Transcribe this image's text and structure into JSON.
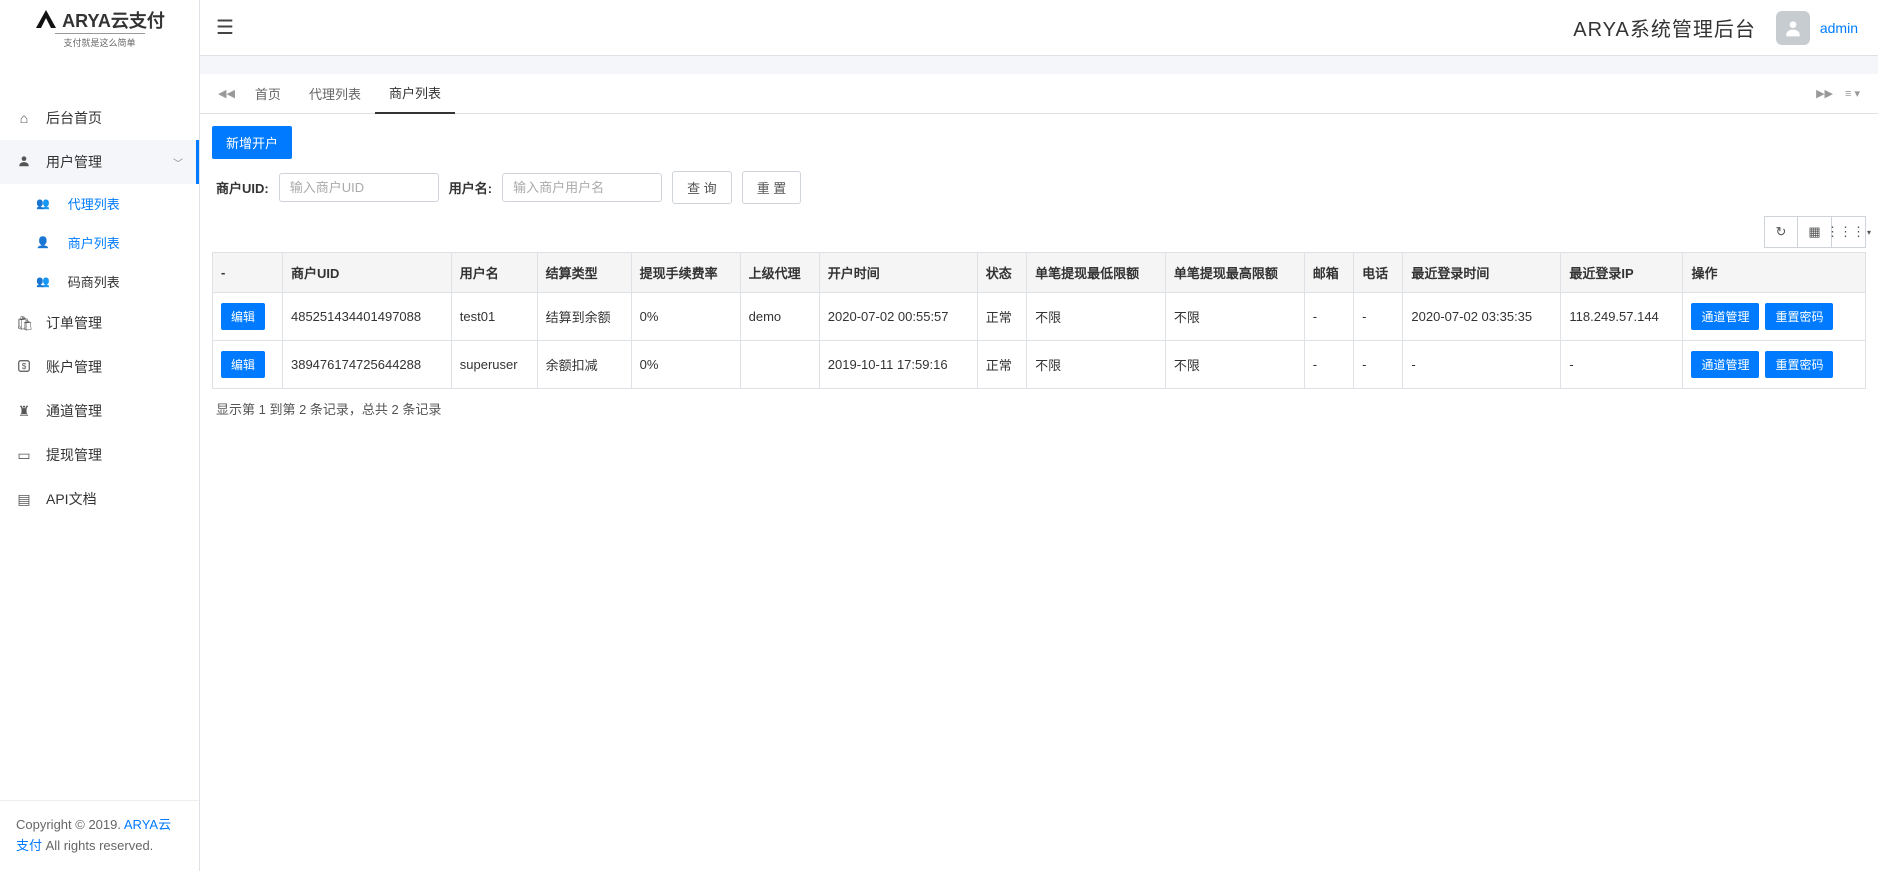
{
  "logo": {
    "brand": "ARYA云支付",
    "slogan": "支付就是这么简单"
  },
  "topbar": {
    "system_title": "ARYA系统管理后台",
    "username": "admin"
  },
  "sidebar": {
    "items": [
      {
        "label": "后台首页"
      },
      {
        "label": "用户管理",
        "expanded": true
      },
      {
        "label": "订单管理"
      },
      {
        "label": "账户管理"
      },
      {
        "label": "通道管理"
      },
      {
        "label": "提现管理"
      },
      {
        "label": "API文档"
      }
    ],
    "sub_items": [
      {
        "label": "代理列表"
      },
      {
        "label": "商户列表"
      },
      {
        "label": "码商列表"
      }
    ]
  },
  "tabs": {
    "items": [
      {
        "label": "首页"
      },
      {
        "label": "代理列表"
      },
      {
        "label": "商户列表"
      }
    ]
  },
  "actions": {
    "new_account": "新增开户"
  },
  "search": {
    "uid_label": "商户UID:",
    "uid_placeholder": "输入商户UID",
    "username_label": "用户名:",
    "username_placeholder": "输入商户用户名",
    "query_btn": "查 询",
    "reset_btn": "重 置"
  },
  "table": {
    "headers": [
      "-",
      "商户UID",
      "用户名",
      "结算类型",
      "提现手续费率",
      "上级代理",
      "开户时间",
      "状态",
      "单笔提现最低限额",
      "单笔提现最高限额",
      "邮箱",
      "电话",
      "最近登录时间",
      "最近登录IP",
      "操作"
    ],
    "edit_btn": "编辑",
    "channel_btn": "通道管理",
    "reset_pwd_btn": "重置密码",
    "rows": [
      {
        "uid": "485251434401497088",
        "username": "test01",
        "settle_type": "结算到余额",
        "fee_rate": "0%",
        "parent_agent": "demo",
        "open_time": "2020-07-02 00:55:57",
        "status": "正常",
        "min_limit": "不限",
        "max_limit": "不限",
        "email": "-",
        "phone": "-",
        "last_login_time": "2020-07-02 03:35:35",
        "last_login_ip": "118.249.57.144"
      },
      {
        "uid": "389476174725644288",
        "username": "superuser",
        "settle_type": "余额扣减",
        "fee_rate": "0%",
        "parent_agent": "",
        "open_time": "2019-10-11 17:59:16",
        "status": "正常",
        "min_limit": "不限",
        "max_limit": "不限",
        "email": "-",
        "phone": "-",
        "last_login_time": "-",
        "last_login_ip": "-"
      }
    ]
  },
  "pagination_info": "显示第 1 到第 2 条记录，总共 2 条记录",
  "footer": {
    "copyright": "Copyright © 2019. ",
    "brand": "ARYA云支付",
    "rights": " All rights reserved."
  }
}
